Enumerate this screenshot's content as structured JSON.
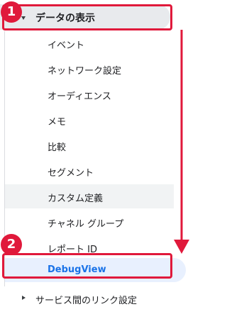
{
  "section": {
    "label": "データの表示"
  },
  "items": [
    {
      "label": "イベント"
    },
    {
      "label": "ネットワーク設定"
    },
    {
      "label": "オーディエンス"
    },
    {
      "label": "メモ"
    },
    {
      "label": "比較"
    },
    {
      "label": "セグメント"
    },
    {
      "label": "カスタム定義"
    },
    {
      "label": "チャネル グループ"
    },
    {
      "label": "レポート ID"
    },
    {
      "label": "DebugView"
    }
  ],
  "bottom_section": {
    "label": "サービス間のリンク設定"
  },
  "annotations": {
    "step1": "1",
    "step2": "2"
  },
  "colors": {
    "annotation": "#e0193b",
    "selected_text": "#1a73e8",
    "selected_bg": "#e8f0fe"
  }
}
